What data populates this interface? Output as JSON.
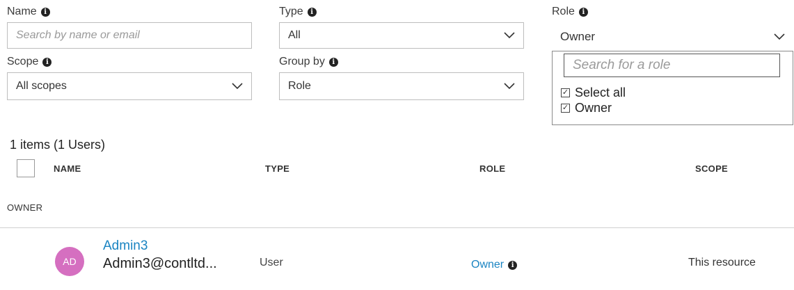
{
  "filters": {
    "name": {
      "label": "Name",
      "placeholder": "Search by name or email"
    },
    "type": {
      "label": "Type",
      "value": "All"
    },
    "role": {
      "label": "Role",
      "value": "Owner"
    },
    "scope": {
      "label": "Scope",
      "value": "All scopes"
    },
    "group_by": {
      "label": "Group by",
      "value": "Role"
    }
  },
  "role_dropdown": {
    "search_placeholder": "Search for a role",
    "options": [
      {
        "label": "Select all",
        "checked": true
      },
      {
        "label": "Owner",
        "checked": true
      }
    ]
  },
  "results": {
    "count_text": "1 items (1 Users)",
    "columns": [
      "NAME",
      "TYPE",
      "ROLE",
      "SCOPE"
    ],
    "group_label": "OWNER",
    "rows": [
      {
        "initials": "AD",
        "name": "Admin3",
        "email": "Admin3@contltd...",
        "type": "User",
        "role": "Owner",
        "scope": "This resource"
      }
    ]
  },
  "colors": {
    "accent": "#1a84c2",
    "avatar": "#d56fc0"
  }
}
